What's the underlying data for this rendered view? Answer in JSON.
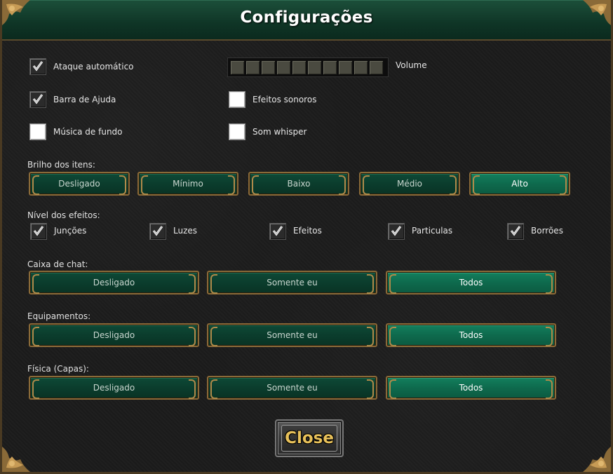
{
  "window": {
    "title": "Configurações"
  },
  "options": {
    "auto_attack": {
      "label": "Ataque automático",
      "checked": true
    },
    "help_bar": {
      "label": "Barra de Ajuda",
      "checked": true
    },
    "background_music": {
      "label": "Música de fundo",
      "checked": false
    },
    "sound_effects": {
      "label": "Efeitos sonoros",
      "checked": false
    },
    "whisper_sound": {
      "label": "Som whisper",
      "checked": false
    },
    "volume": {
      "label": "Volume",
      "level": 0,
      "segments": 10
    }
  },
  "item_brightness": {
    "label": "Brilho dos itens:",
    "options": [
      "Desligado",
      "Mínimo",
      "Baixo",
      "Médio",
      "Alto"
    ],
    "selected": "Alto"
  },
  "effects_level": {
    "label": "Nível dos efeitos:",
    "items": [
      {
        "label": "Junções",
        "checked": true
      },
      {
        "label": "Luzes",
        "checked": true
      },
      {
        "label": "Efeitos",
        "checked": true
      },
      {
        "label": "Particulas",
        "checked": true
      },
      {
        "label": "Borrões",
        "checked": true
      }
    ]
  },
  "chat_box": {
    "label": "Caixa de chat:",
    "options": [
      "Desligado",
      "Somente eu",
      "Todos"
    ],
    "selected": "Todos"
  },
  "equipment": {
    "label": "Equipamentos:",
    "options": [
      "Desligado",
      "Somente eu",
      "Todos"
    ],
    "selected": "Todos"
  },
  "physics": {
    "label": "Física (Capas):",
    "options": [
      "Desligado",
      "Somente eu",
      "Todos"
    ],
    "selected": "Todos"
  },
  "close_button": {
    "label": "Close"
  },
  "colors": {
    "accent_green": "#0e6a4d",
    "gold_border": "#8a6a38",
    "close_text": "#e8c15a"
  }
}
